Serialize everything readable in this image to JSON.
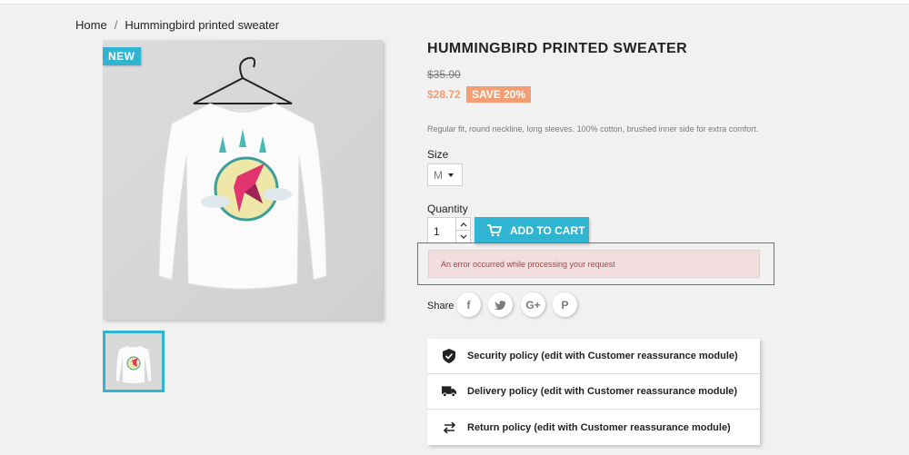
{
  "breadcrumb": {
    "home": "Home",
    "separator": "/",
    "current": "Hummingbird printed sweater"
  },
  "product": {
    "flag": "NEW",
    "title": "HUMMINGBIRD PRINTED SWEATER",
    "old_price": "$35.90",
    "price": "$28.72",
    "discount": "SAVE 20%",
    "description": "Regular fit, round neckline, long sleeves. 100% cotton, brushed inner side for extra comfort."
  },
  "size": {
    "label": "Size",
    "selected": "M"
  },
  "quantity": {
    "label": "Quantity",
    "value": "1"
  },
  "add_to_cart": {
    "label": "ADD TO CART"
  },
  "error": {
    "message": "An error occurred while processing your request"
  },
  "share": {
    "label": "Share",
    "networks": [
      {
        "name": "facebook",
        "glyph": "f"
      },
      {
        "name": "twitter",
        "glyph": "t"
      },
      {
        "name": "google-plus",
        "glyph": "G+"
      },
      {
        "name": "pinterest",
        "glyph": "P"
      }
    ]
  },
  "reassurance": [
    {
      "icon": "shield-check-icon",
      "label": "Security policy (edit with Customer reassurance module)"
    },
    {
      "icon": "truck-icon",
      "label": "Delivery policy (edit with Customer reassurance module)"
    },
    {
      "icon": "swap-arrows-icon",
      "label": "Return policy (edit with Customer reassurance module)"
    }
  ],
  "colors": {
    "accent": "#2fb5d2",
    "discount": "#f39d72",
    "error_bg": "#f2dede",
    "error_text": "#a94442"
  }
}
